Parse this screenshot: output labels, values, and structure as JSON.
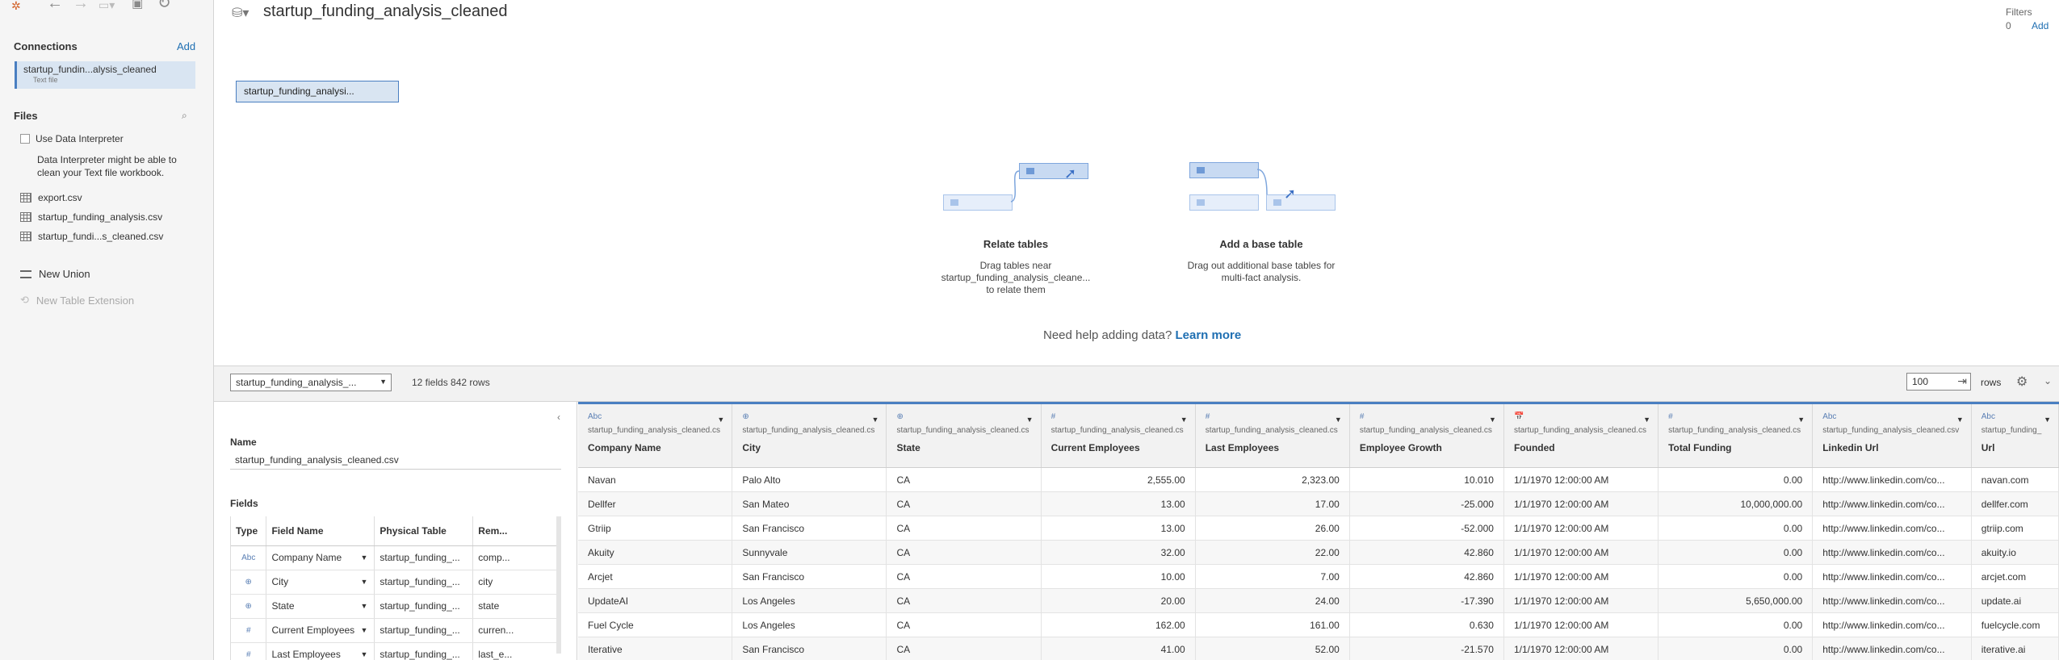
{
  "connections": {
    "title": "Connections",
    "add_label": "Add",
    "items": [
      {
        "name": "startup_fundin...alysis_cleaned",
        "type": "Text file"
      }
    ]
  },
  "files": {
    "title": "Files",
    "data_interpreter": {
      "label": "Use Data Interpreter",
      "description": "Data Interpreter might be able to clean your Text file workbook."
    },
    "items": [
      "export.csv",
      "startup_funding_analysis.csv",
      "startup_fundi...s_cleaned.csv"
    ],
    "new_union": "New Union",
    "new_table_extension": "New Table Extension"
  },
  "canvas": {
    "datasource_title": "startup_funding_analysis_cleaned",
    "filters_label": "Filters",
    "filters_count": "0",
    "filters_add": "Add",
    "table_chip": "startup_funding_analysi...",
    "relate": {
      "title": "Relate tables",
      "line1": "Drag tables near",
      "line2": "startup_funding_analysis_cleane...",
      "line3": "to relate them"
    },
    "base": {
      "title": "Add a base table",
      "line1": "Drag out additional base tables for",
      "line2": "multi-fact analysis."
    },
    "help_text": "Need help adding data?",
    "learn_more": "Learn more"
  },
  "bottom": {
    "table_select": "startup_funding_analysis_...",
    "field_count": "12 fields 842 rows",
    "rows_value": "100",
    "rows_label": "rows"
  },
  "metadata": {
    "name_label": "Name",
    "name_value": "startup_funding_analysis_cleaned.csv",
    "fields_label": "Fields",
    "headers": [
      "Type",
      "Field Name",
      "Physical Table",
      "Rem..."
    ],
    "rows": [
      {
        "type": "Abc",
        "field": "Company Name",
        "table": "startup_funding_...",
        "remote": "comp..."
      },
      {
        "type": "⊕",
        "field": "City",
        "table": "startup_funding_...",
        "remote": "city"
      },
      {
        "type": "⊕",
        "field": "State",
        "table": "startup_funding_...",
        "remote": "state"
      },
      {
        "type": "#",
        "field": "Current Employees",
        "table": "startup_funding_...",
        "remote": "curren..."
      },
      {
        "type": "#",
        "field": "Last Employees",
        "table": "startup_funding_...",
        "remote": "last_e..."
      }
    ]
  },
  "grid": {
    "columns": [
      {
        "type": "Abc",
        "source": "startup_funding_analysis_cleaned.cs",
        "name": "Company Name"
      },
      {
        "type": "⊕",
        "source": "startup_funding_analysis_cleaned.cs",
        "name": "City"
      },
      {
        "type": "⊕",
        "source": "startup_funding_analysis_cleaned.cs",
        "name": "State"
      },
      {
        "type": "#",
        "source": "startup_funding_analysis_cleaned.cs",
        "name": "Current Employees"
      },
      {
        "type": "#",
        "source": "startup_funding_analysis_cleaned.cs",
        "name": "Last Employees"
      },
      {
        "type": "#",
        "source": "startup_funding_analysis_cleaned.cs",
        "name": "Employee Growth"
      },
      {
        "type": "📅",
        "source": "startup_funding_analysis_cleaned.cs",
        "name": "Founded"
      },
      {
        "type": "#",
        "source": "startup_funding_analysis_cleaned.cs",
        "name": "Total Funding"
      },
      {
        "type": "Abc",
        "source": "startup_funding_analysis_cleaned.csv",
        "name": "Linkedin Url"
      },
      {
        "type": "Abc",
        "source": "startup_funding_",
        "name": "Url"
      }
    ],
    "rows": [
      [
        "Navan",
        "Palo Alto",
        "CA",
        "2,555.00",
        "2,323.00",
        "10.010",
        "1/1/1970 12:00:00 AM",
        "0.00",
        "http://www.linkedin.com/co...",
        "navan.com"
      ],
      [
        "Dellfer",
        "San Mateo",
        "CA",
        "13.00",
        "17.00",
        "-25.000",
        "1/1/1970 12:00:00 AM",
        "10,000,000.00",
        "http://www.linkedin.com/co...",
        "dellfer.com"
      ],
      [
        "Gtriip",
        "San Francisco",
        "CA",
        "13.00",
        "26.00",
        "-52.000",
        "1/1/1970 12:00:00 AM",
        "0.00",
        "http://www.linkedin.com/co...",
        "gtriip.com"
      ],
      [
        "Akuity",
        "Sunnyvale",
        "CA",
        "32.00",
        "22.00",
        "42.860",
        "1/1/1970 12:00:00 AM",
        "0.00",
        "http://www.linkedin.com/co...",
        "akuity.io"
      ],
      [
        "Arcjet",
        "San Francisco",
        "CA",
        "10.00",
        "7.00",
        "42.860",
        "1/1/1970 12:00:00 AM",
        "0.00",
        "http://www.linkedin.com/co...",
        "arcjet.com"
      ],
      [
        "UpdateAI",
        "Los Angeles",
        "CA",
        "20.00",
        "24.00",
        "-17.390",
        "1/1/1970 12:00:00 AM",
        "5,650,000.00",
        "http://www.linkedin.com/co...",
        "update.ai"
      ],
      [
        "Fuel Cycle",
        "Los Angeles",
        "CA",
        "162.00",
        "161.00",
        "0.630",
        "1/1/1970 12:00:00 AM",
        "0.00",
        "http://www.linkedin.com/co...",
        "fuelcycle.com"
      ],
      [
        "Iterative",
        "San Francisco",
        "CA",
        "41.00",
        "52.00",
        "-21.570",
        "1/1/1970 12:00:00 AM",
        "0.00",
        "http://www.linkedin.com/co...",
        "iterative.ai"
      ]
    ]
  },
  "colors": {
    "accent": "#4a7fc1",
    "link": "#1f6fb2",
    "selected_bg": "#d9e5f2"
  },
  "icons": [
    "tableau-logo-icon",
    "back-icon",
    "forward-icon",
    "save-icon",
    "refresh-icon",
    "search-icon",
    "gear-icon",
    "chevron-down-icon"
  ]
}
